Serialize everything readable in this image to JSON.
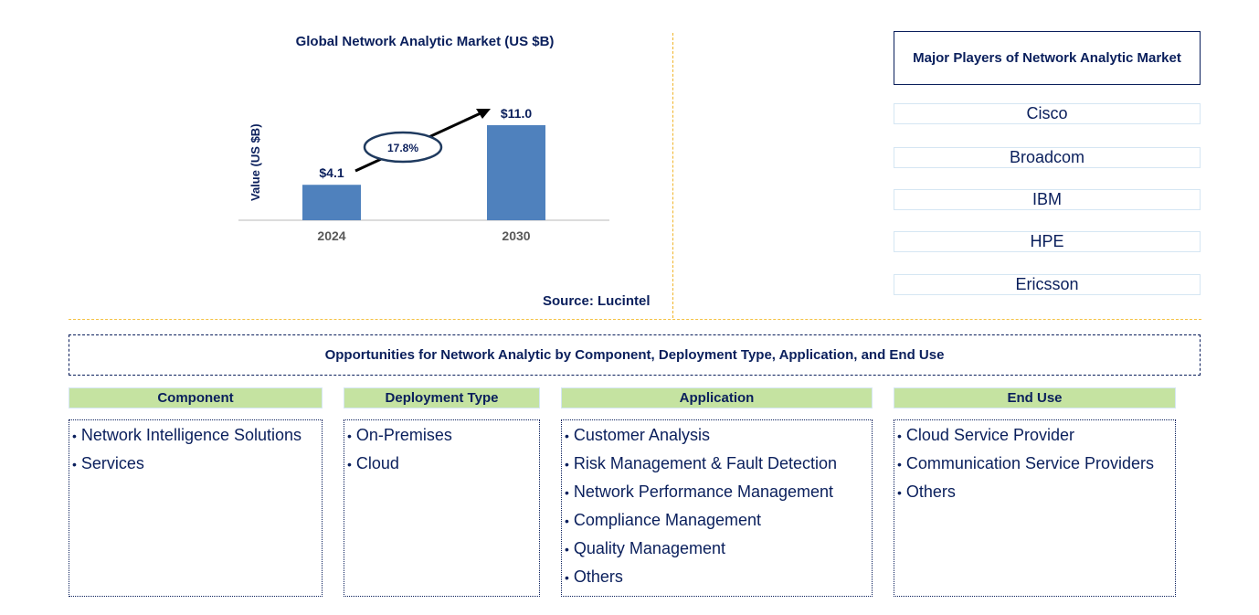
{
  "chart_data": {
    "type": "bar",
    "title": "Global Network Analytic Market (US $B)",
    "xlabel": "",
    "ylabel": "Value (US $B)",
    "categories": [
      "2024",
      "2030"
    ],
    "values": [
      4.1,
      11.0
    ],
    "data_labels": [
      "$4.1",
      "$11.0"
    ],
    "ylim": [
      0,
      11.0
    ],
    "grid": false,
    "bar_color": "#4f81bd",
    "annotation": {
      "text": "17.8%",
      "type": "CAGR arrow",
      "from": "2024",
      "to": "2030"
    }
  },
  "source": "Source: Lucintel",
  "players": {
    "title": "Major Players of Network Analytic Market",
    "items": [
      "Cisco",
      "Broadcom",
      "IBM",
      "HPE",
      "Ericsson"
    ]
  },
  "opportunities": {
    "title": "Opportunities for Network Analytic by Component, Deployment Type, Application, and End Use",
    "segments": [
      {
        "name": "Component",
        "items": [
          "Network Intelligence Solutions",
          "Services"
        ]
      },
      {
        "name": "Deployment Type",
        "items": [
          "On-Premises",
          "Cloud"
        ]
      },
      {
        "name": "Application",
        "items": [
          "Customer Analysis",
          "Risk Management & Fault Detection",
          "Network Performance Management",
          "Compliance Management",
          "Quality Management",
          "Others"
        ]
      },
      {
        "name": "End Use",
        "items": [
          "Cloud Service Provider",
          "Communication Service Providers",
          "Others"
        ]
      }
    ]
  },
  "colors": {
    "text": "#0a1f5c",
    "bar": "#4f81bd",
    "segment_header": "#c5e3a1",
    "divider": "#f0b429"
  }
}
